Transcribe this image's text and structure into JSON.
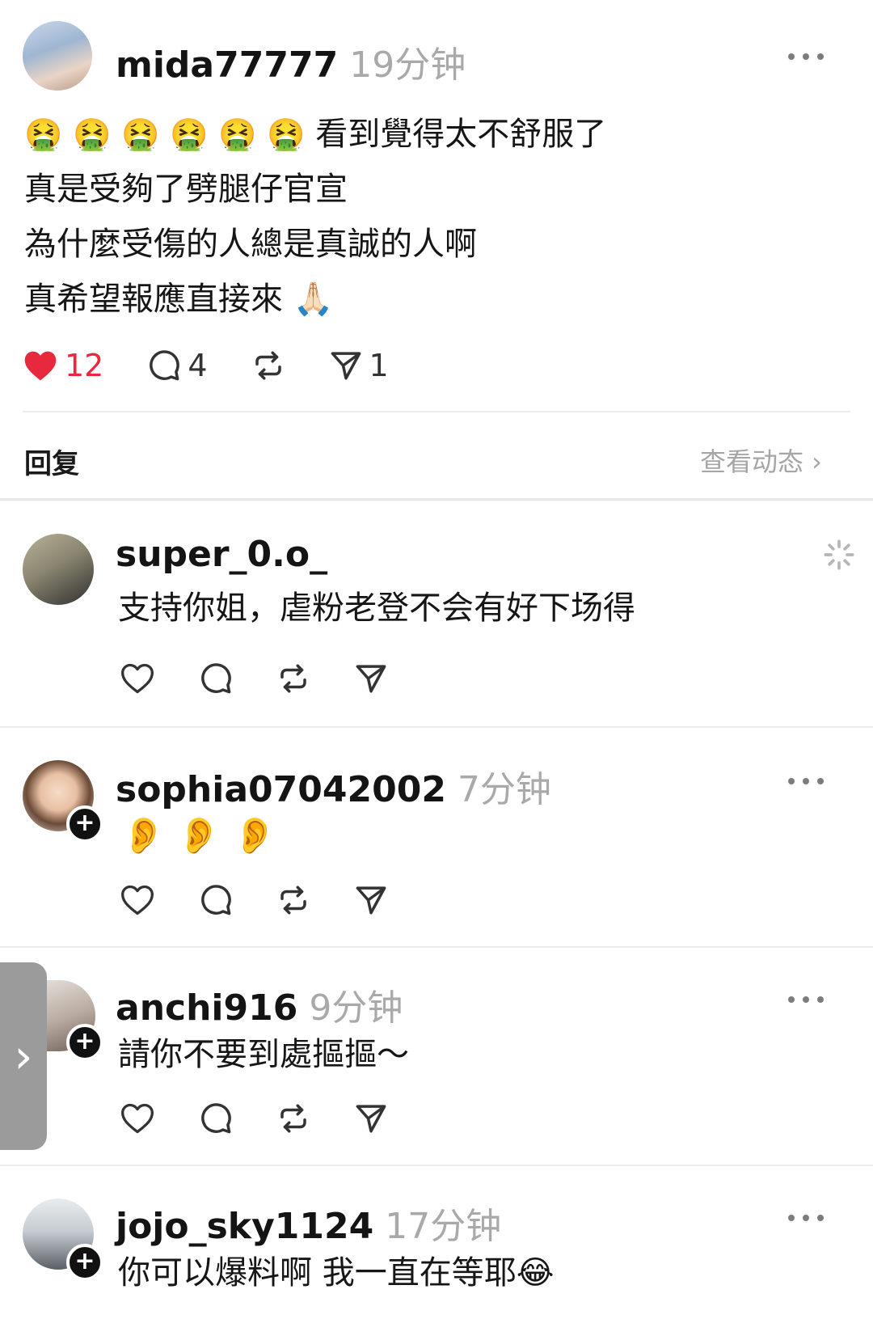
{
  "post": {
    "username": "mida77777",
    "timestamp": "19分钟",
    "reaction_emojis": [
      "🤮",
      "🤮",
      "🤮",
      "🤮",
      "🤮",
      "🤮"
    ],
    "lines": [
      "看到覺得太不舒服了",
      "真是受夠了劈腿仔官宣",
      "為什麼受傷的人總是真誠的人啊",
      "真希望報應直接來 🙏🏻"
    ],
    "likes": "12",
    "comments": "4",
    "shares": "1"
  },
  "reply_bar": {
    "reply_label": "回复",
    "view_activity_label": "查看动态 ›"
  },
  "comments": [
    {
      "username": "super_0.o_",
      "timestamp": "",
      "text": "支持你姐，虐粉老登不会有好下场得"
    },
    {
      "username": "sophia07042002",
      "timestamp": "7分钟",
      "text": "👂👂👂"
    },
    {
      "username": "anchi916",
      "timestamp": "9分钟",
      "text": "請你不要到處摳摳～"
    },
    {
      "username": "jojo_sky1124",
      "timestamp": "17分钟",
      "text": "你可以爆料啊 我一直在等耶😂"
    }
  ],
  "side_tab": {
    "label": "›"
  },
  "colors": {
    "like_red": "#e8283d",
    "muted": "#a9a9a9",
    "divider": "#ececec"
  },
  "icons": [
    "heart-icon",
    "comment-icon",
    "repost-icon",
    "share-icon",
    "more-icon",
    "plus-icon",
    "loading-icon"
  ]
}
